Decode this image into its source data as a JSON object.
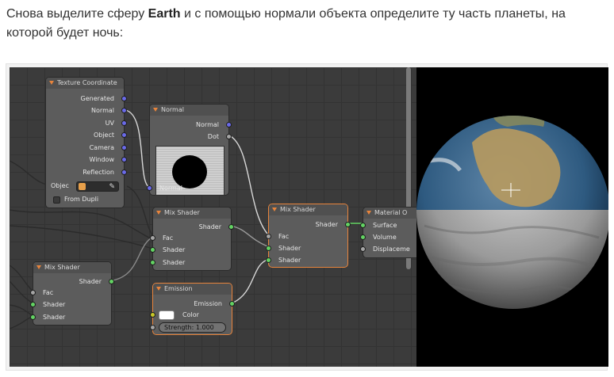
{
  "caption": {
    "before": "Снова выделите сферу ",
    "bold": "Earth",
    "after": " и с помощью нормали объекта определите ту часть планеты, на которой будет ночь:"
  },
  "nodes": {
    "texture_coordinate": {
      "title": "Texture Coordinate",
      "outputs": [
        "Generated",
        "Normal",
        "UV",
        "Object",
        "Camera",
        "Window",
        "Reflection"
      ],
      "object_label": "Objec",
      "from_dupli": "From Dupli"
    },
    "normal": {
      "title": "Normal",
      "outputs": [
        "Normal",
        "Dot"
      ],
      "input": "Normal"
    },
    "mix_shader_top": {
      "title": "Mix Shader",
      "output": "Shader",
      "inputs": [
        "Fac",
        "Shader",
        "Shader"
      ]
    },
    "mix_shader_left": {
      "title": "Mix Shader",
      "output": "Shader",
      "inputs": [
        "Fac",
        "Shader",
        "Shader"
      ]
    },
    "mix_shader_right": {
      "title": "Mix Shader",
      "output": "Shader",
      "inputs": [
        "Fac",
        "Shader",
        "Shader"
      ]
    },
    "emission": {
      "title": "Emission",
      "output": "Emission",
      "color_label": "Color",
      "strength": "Strength:  1.000"
    },
    "material_output": {
      "title": "Material O",
      "inputs": [
        "Surface",
        "Volume",
        "Displaceme"
      ]
    }
  },
  "colors": {
    "accent": "#e8843c",
    "vector_socket": "#6a6ae8",
    "shader_socket": "#63d363",
    "fac_socket": "#a5a5a5",
    "color_socket": "#c8c828"
  }
}
